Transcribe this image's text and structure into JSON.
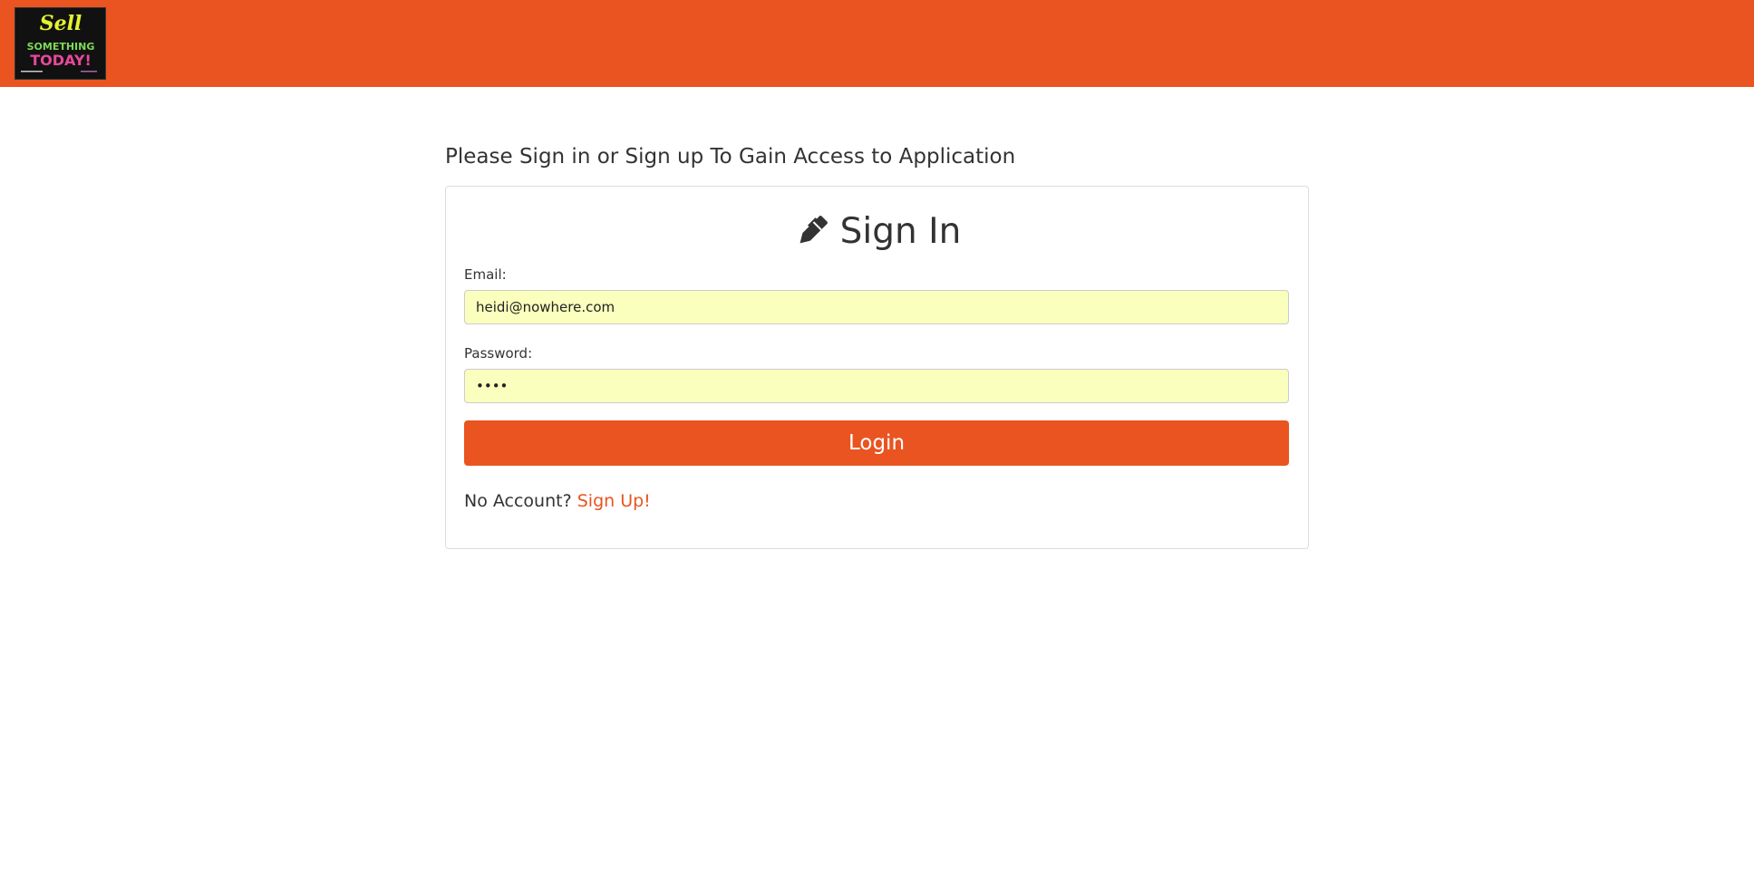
{
  "header": {
    "logo": {
      "line1": "Sell",
      "line2": "SOMETHING",
      "line3": "TODAY!"
    }
  },
  "main": {
    "intro": "Please Sign in or Sign up To Gain Access to Application",
    "card": {
      "title": "Sign In",
      "title_icon": "pen-icon",
      "email_label": "Email:",
      "email_value": "heidi@nowhere.com",
      "password_label": "Password:",
      "password_value": "abcd",
      "login_label": "Login",
      "signup_prompt": "No Account?",
      "signup_link": "Sign Up!"
    }
  },
  "colors": {
    "brand": "#e95420",
    "autofill": "#faffbd"
  }
}
